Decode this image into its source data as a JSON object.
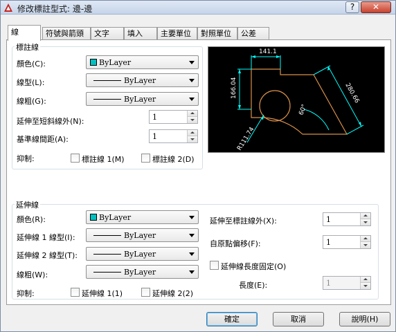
{
  "window": {
    "title": "修改標註型式: 邊-邊",
    "help_label": "?",
    "close_label": "✕"
  },
  "tabs": [
    {
      "label": "線",
      "active": true
    },
    {
      "label": "符號與箭頭"
    },
    {
      "label": "文字"
    },
    {
      "label": "填入"
    },
    {
      "label": "主要單位"
    },
    {
      "label": "對照單位"
    },
    {
      "label": "公差"
    }
  ],
  "dimension_lines": {
    "group_label": "標註線",
    "color_label": "顏色(C):",
    "color_value": "ByLayer",
    "linetype_label": "線型(L):",
    "linetype_value": "ByLayer",
    "lineweight_label": "線粗(G):",
    "lineweight_value": "ByLayer",
    "extend_label": "延伸至短斜線外(N):",
    "extend_value": "1",
    "baseline_label": "基準線間距(A):",
    "baseline_value": "1",
    "suppress_label": "抑制:",
    "suppress_1": "標註線 1(M)",
    "suppress_2": "標註線 2(D)"
  },
  "extension_lines": {
    "group_label": "延伸線",
    "color_label": "顏色(R):",
    "color_value": "ByLayer",
    "linetype1_label": "延伸線 1 線型(I):",
    "linetype1_value": "ByLayer",
    "linetype2_label": "延伸線 2 線型(T):",
    "linetype2_value": "ByLayer",
    "lineweight_label": "線粗(W):",
    "lineweight_value": "ByLayer",
    "suppress_label": "抑制:",
    "suppress_1": "延伸線 1(1)",
    "suppress_2": "延伸線 2(2)",
    "extend_beyond_label": "延伸至標註線外(X):",
    "extend_beyond_value": "1",
    "offset_label": "自原點偏移(F):",
    "offset_value": "1",
    "fixed_length_label": "延伸線長度固定(O)",
    "length_label": "長度(E):",
    "length_value": "1"
  },
  "preview": {
    "dim_top": "141.1",
    "dim_left": "166.04",
    "dim_right": "280.66",
    "dim_angle": "60°",
    "dim_radius": "R111.74"
  },
  "buttons": {
    "ok": "確定",
    "cancel": "取消",
    "help": "說明(H)"
  },
  "colors": {
    "bylayer_swatch": "#00c0c0",
    "preview_bg": "#000000",
    "geometry": "#d9904a",
    "dimension": "#00ffff"
  }
}
